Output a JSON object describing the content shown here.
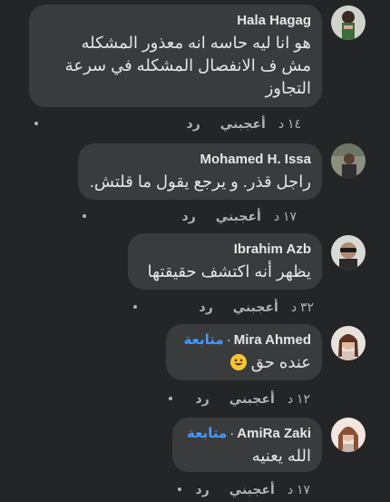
{
  "comments": [
    {
      "author": "Hala Hagag",
      "text": "هو انا ليه حاسه انه معذور المشكله\nمش ف الانفصال المشكله في سرعة\nالتجاوز",
      "time": "١٤ د",
      "like": "أعجبني",
      "reply": "رد"
    },
    {
      "author": "Mohamed H. Issa",
      "text": "راجل قذر. و يرجع يقول ما قلتش.",
      "time": "١٧ د",
      "like": "أعجبني",
      "reply": "رد"
    },
    {
      "author": "Ibrahim Azb",
      "text": "يظهر أنه اكتشف حقيقتها",
      "time": "٣٢ د",
      "like": "أعجبني",
      "reply": "رد"
    },
    {
      "author": "Mira Ahmed",
      "follow": "متابعة",
      "text": "عنده حق",
      "emoji": "grinning-face-emoji",
      "time": "١٢ د",
      "like": "أعجبني",
      "reply": "رد"
    },
    {
      "author": "AmiRa Zaki",
      "follow": "متابعة",
      "text": "الله يعنيه",
      "time": "١٧ د",
      "like": "أعجبني",
      "reply": "رد"
    }
  ],
  "colors": {
    "background": "#242526",
    "bubble": "#3a3b3c",
    "text": "#e4e6eb",
    "secondary": "#b0b3b8",
    "follow": "#4599ff"
  }
}
